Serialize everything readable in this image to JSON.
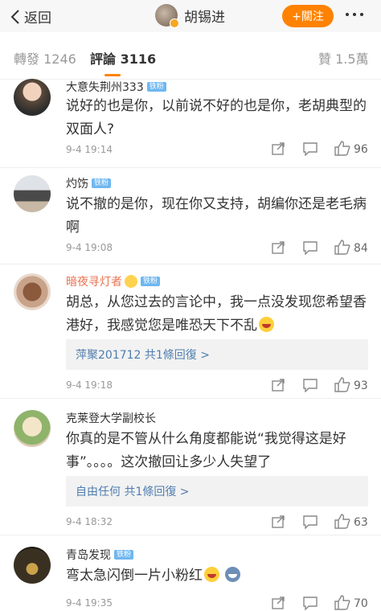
{
  "header": {
    "back_label": "返回",
    "title": "胡锡进",
    "follow_label": "+關注"
  },
  "tabs": [
    {
      "label": "轉發 1246",
      "active": false
    },
    {
      "label": "評論 3116",
      "active": true
    },
    {
      "label": "贊 1.5萬",
      "active": false
    }
  ],
  "colors": {
    "accent": "#ff8200",
    "link": "#507daf",
    "badge": "#6fb7f0"
  },
  "comments": [
    {
      "user": "大意失荆州333",
      "badge": "铁粉",
      "text": "说好的也是你，以前说不好的也是你，老胡典型的双面人?",
      "time": "9-4 19:14",
      "likes": "96"
    },
    {
      "user": "灼饬",
      "badge": "铁粉",
      "text": "说不撤的是你，现在你又支持，胡编你还是老毛病啊",
      "time": "9-4 19:08",
      "likes": "84"
    },
    {
      "user": "暗夜寻灯者",
      "badge": "铁粉",
      "text": "胡总，从您过去的言论中，我一点没发现您希望香港好，我感觉您是唯恐天下不乱",
      "reply": "萍聚201712  共1條回復 >",
      "time": "9-4 19:18",
      "likes": "93"
    },
    {
      "user": "克莱登大学副校长",
      "text": "你真的是不管从什么角度都能说“我觉得这是好事”。。。。这次撤回让多少人失望了",
      "reply": "自由任何  共1條回復 >",
      "time": "9-4 18:32",
      "likes": "63"
    },
    {
      "user": "青岛发现",
      "badge": "铁粉",
      "text": "弯太急闪倒一片小粉红",
      "time": "9-4 19:35",
      "likes": "70"
    }
  ]
}
